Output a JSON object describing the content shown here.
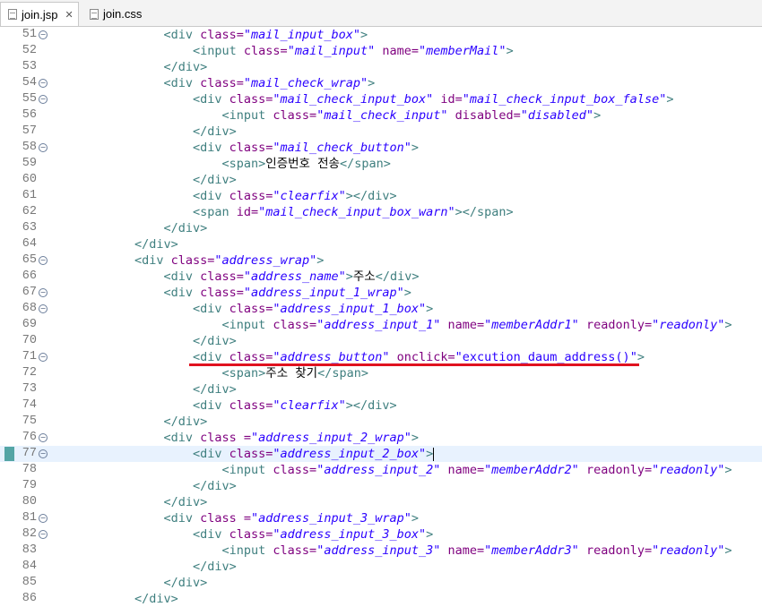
{
  "tabs": [
    {
      "label": "join.jsp",
      "active": true,
      "icon": "file-icon",
      "closable": true
    },
    {
      "label": "join.css",
      "active": false,
      "icon": "file-icon",
      "closable": false
    }
  ],
  "current_line": 77,
  "annotation": {
    "line": 71,
    "color": "#e0121f"
  },
  "lines": [
    {
      "n": "51",
      "fold": true,
      "indent": 4,
      "tokens": [
        [
          "t",
          "<div"
        ],
        [
          "a",
          " class="
        ],
        [
          "v",
          "\"mail_input_box\""
        ],
        [
          "t",
          ">"
        ]
      ]
    },
    {
      "n": "52",
      "fold": false,
      "indent": 5,
      "tokens": [
        [
          "t",
          "<input"
        ],
        [
          "a",
          " class="
        ],
        [
          "v",
          "\"mail_input\""
        ],
        [
          "a",
          " name="
        ],
        [
          "v",
          "\"memberMail\""
        ],
        [
          "t",
          ">"
        ]
      ]
    },
    {
      "n": "53",
      "fold": false,
      "indent": 4,
      "tokens": [
        [
          "t",
          "</div>"
        ]
      ]
    },
    {
      "n": "54",
      "fold": true,
      "indent": 4,
      "tokens": [
        [
          "t",
          "<div"
        ],
        [
          "a",
          " class="
        ],
        [
          "v",
          "\"mail_check_wrap\""
        ],
        [
          "t",
          ">"
        ]
      ]
    },
    {
      "n": "55",
      "fold": true,
      "indent": 5,
      "tokens": [
        [
          "t",
          "<div"
        ],
        [
          "a",
          " class="
        ],
        [
          "v",
          "\"mail_check_input_box\""
        ],
        [
          "a",
          " id="
        ],
        [
          "v",
          "\"mail_check_input_box_false\""
        ],
        [
          "t",
          ">"
        ]
      ]
    },
    {
      "n": "56",
      "fold": false,
      "indent": 6,
      "tokens": [
        [
          "t",
          "<input"
        ],
        [
          "a",
          " class="
        ],
        [
          "v",
          "\"mail_check_input\""
        ],
        [
          "a",
          " disabled="
        ],
        [
          "v",
          "\"disabled\""
        ],
        [
          "t",
          ">"
        ]
      ]
    },
    {
      "n": "57",
      "fold": false,
      "indent": 5,
      "tokens": [
        [
          "t",
          "</div>"
        ]
      ]
    },
    {
      "n": "58",
      "fold": true,
      "indent": 5,
      "tokens": [
        [
          "t",
          "<div"
        ],
        [
          "a",
          " class="
        ],
        [
          "v",
          "\"mail_check_button\""
        ],
        [
          "t",
          ">"
        ]
      ]
    },
    {
      "n": "59",
      "fold": false,
      "indent": 6,
      "tokens": [
        [
          "t",
          "<span>"
        ],
        [
          "txt",
          "인증번호 전송"
        ],
        [
          "t",
          "</span>"
        ]
      ]
    },
    {
      "n": "60",
      "fold": false,
      "indent": 5,
      "tokens": [
        [
          "t",
          "</div>"
        ]
      ]
    },
    {
      "n": "61",
      "fold": false,
      "indent": 5,
      "tokens": [
        [
          "t",
          "<div"
        ],
        [
          "a",
          " class="
        ],
        [
          "v",
          "\"clearfix\""
        ],
        [
          "t",
          "></div>"
        ]
      ]
    },
    {
      "n": "62",
      "fold": false,
      "indent": 5,
      "tokens": [
        [
          "t",
          "<span"
        ],
        [
          "a",
          " id="
        ],
        [
          "v",
          "\"mail_check_input_box_warn\""
        ],
        [
          "t",
          "></span>"
        ]
      ]
    },
    {
      "n": "63",
      "fold": false,
      "indent": 4,
      "tokens": [
        [
          "t",
          "</div>"
        ]
      ]
    },
    {
      "n": "64",
      "fold": false,
      "indent": 3,
      "tokens": [
        [
          "t",
          "</div>"
        ]
      ]
    },
    {
      "n": "65",
      "fold": true,
      "indent": 3,
      "tokens": [
        [
          "t",
          "<div"
        ],
        [
          "a",
          " class="
        ],
        [
          "v",
          "\"address_wrap\""
        ],
        [
          "t",
          ">"
        ]
      ]
    },
    {
      "n": "66",
      "fold": false,
      "indent": 4,
      "tokens": [
        [
          "t",
          "<div"
        ],
        [
          "a",
          " class="
        ],
        [
          "v",
          "\"address_name\""
        ],
        [
          "t",
          ">"
        ],
        [
          "txt",
          "주소"
        ],
        [
          "t",
          "</div>"
        ]
      ]
    },
    {
      "n": "67",
      "fold": true,
      "indent": 4,
      "tokens": [
        [
          "t",
          "<div"
        ],
        [
          "a",
          " class="
        ],
        [
          "v",
          "\"address_input_1_wrap\""
        ],
        [
          "t",
          ">"
        ]
      ]
    },
    {
      "n": "68",
      "fold": true,
      "indent": 5,
      "tokens": [
        [
          "t",
          "<div"
        ],
        [
          "a",
          " class="
        ],
        [
          "v",
          "\"address_input_1_box\""
        ],
        [
          "t",
          ">"
        ]
      ]
    },
    {
      "n": "69",
      "fold": false,
      "indent": 6,
      "tokens": [
        [
          "t",
          "<input"
        ],
        [
          "a",
          " class="
        ],
        [
          "v",
          "\"address_input_1\""
        ],
        [
          "a",
          " name="
        ],
        [
          "v",
          "\"memberAddr1\""
        ],
        [
          "a",
          " readonly="
        ],
        [
          "v",
          "\"readonly\""
        ],
        [
          "t",
          ">"
        ]
      ]
    },
    {
      "n": "70",
      "fold": false,
      "indent": 5,
      "tokens": [
        [
          "t",
          "</div>"
        ]
      ]
    },
    {
      "n": "71",
      "fold": true,
      "indent": 5,
      "tokens": [
        [
          "t",
          "<div"
        ],
        [
          "a",
          " class="
        ],
        [
          "v",
          "\"address_button\""
        ],
        [
          "a",
          " onclick="
        ],
        [
          "vn",
          "\"excution_daum_address()\""
        ],
        [
          "t",
          ">"
        ]
      ]
    },
    {
      "n": "72",
      "fold": false,
      "indent": 6,
      "tokens": [
        [
          "t",
          "<span>"
        ],
        [
          "txt",
          "주소 찾기"
        ],
        [
          "t",
          "</span>"
        ]
      ]
    },
    {
      "n": "73",
      "fold": false,
      "indent": 5,
      "tokens": [
        [
          "t",
          "</div>"
        ]
      ]
    },
    {
      "n": "74",
      "fold": false,
      "indent": 5,
      "tokens": [
        [
          "t",
          "<div"
        ],
        [
          "a",
          " class="
        ],
        [
          "v",
          "\"clearfix\""
        ],
        [
          "t",
          "></div>"
        ]
      ]
    },
    {
      "n": "75",
      "fold": false,
      "indent": 4,
      "tokens": [
        [
          "t",
          "</div>"
        ]
      ]
    },
    {
      "n": "76",
      "fold": true,
      "indent": 4,
      "tokens": [
        [
          "t",
          "<div"
        ],
        [
          "a",
          " class ="
        ],
        [
          "v",
          "\"address_input_2_wrap\""
        ],
        [
          "t",
          ">"
        ]
      ]
    },
    {
      "n": "77",
      "fold": true,
      "indent": 5,
      "tokens": [
        [
          "t",
          "<div"
        ],
        [
          "a",
          " class="
        ],
        [
          "v",
          "\"address_input_2_box\""
        ],
        [
          "t",
          ">"
        ]
      ]
    },
    {
      "n": "78",
      "fold": false,
      "indent": 6,
      "tokens": [
        [
          "t",
          "<input"
        ],
        [
          "a",
          " class="
        ],
        [
          "v",
          "\"address_input_2\""
        ],
        [
          "a",
          " name="
        ],
        [
          "v",
          "\"memberAddr2\""
        ],
        [
          "a",
          " readonly="
        ],
        [
          "v",
          "\"readonly\""
        ],
        [
          "t",
          ">"
        ]
      ]
    },
    {
      "n": "79",
      "fold": false,
      "indent": 5,
      "tokens": [
        [
          "t",
          "</div>"
        ]
      ]
    },
    {
      "n": "80",
      "fold": false,
      "indent": 4,
      "tokens": [
        [
          "t",
          "</div>"
        ]
      ]
    },
    {
      "n": "81",
      "fold": true,
      "indent": 4,
      "tokens": [
        [
          "t",
          "<div"
        ],
        [
          "a",
          " class ="
        ],
        [
          "v",
          "\"address_input_3_wrap\""
        ],
        [
          "t",
          ">"
        ]
      ]
    },
    {
      "n": "82",
      "fold": true,
      "indent": 5,
      "tokens": [
        [
          "t",
          "<div"
        ],
        [
          "a",
          " class="
        ],
        [
          "v",
          "\"address_input_3_box\""
        ],
        [
          "t",
          ">"
        ]
      ]
    },
    {
      "n": "83",
      "fold": false,
      "indent": 6,
      "tokens": [
        [
          "t",
          "<input"
        ],
        [
          "a",
          " class="
        ],
        [
          "v",
          "\"address_input_3\""
        ],
        [
          "a",
          " name="
        ],
        [
          "v",
          "\"memberAddr3\""
        ],
        [
          "a",
          " readonly="
        ],
        [
          "v",
          "\"readonly\""
        ],
        [
          "t",
          ">"
        ]
      ]
    },
    {
      "n": "84",
      "fold": false,
      "indent": 5,
      "tokens": [
        [
          "t",
          "</div>"
        ]
      ]
    },
    {
      "n": "85",
      "fold": false,
      "indent": 4,
      "tokens": [
        [
          "t",
          "</div>"
        ]
      ]
    },
    {
      "n": "86",
      "fold": false,
      "indent": 3,
      "tokens": [
        [
          "t",
          "</div>"
        ]
      ]
    }
  ]
}
